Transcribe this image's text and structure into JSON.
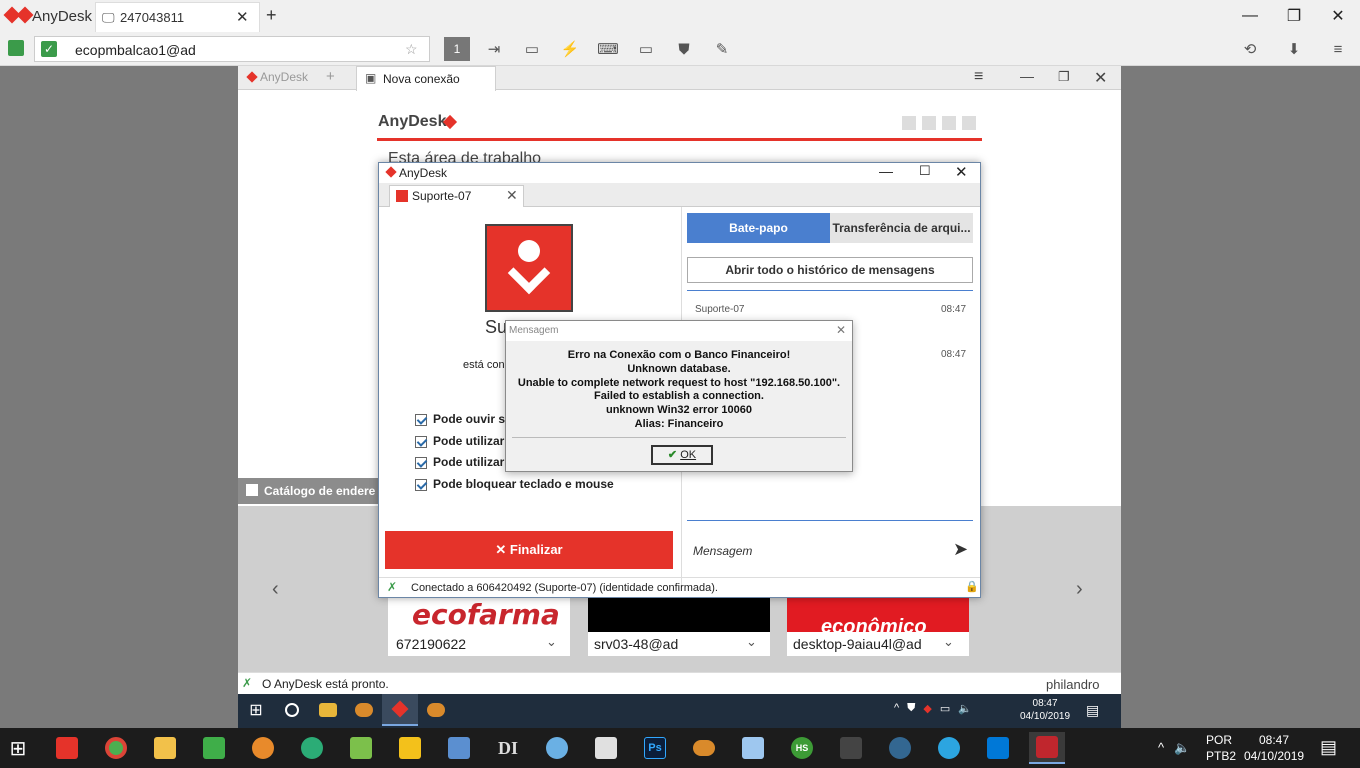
{
  "outer": {
    "app_name": "AnyDesk",
    "tab_label": "247043811",
    "address": "ecopmbalcao1@ad",
    "monitor_number": "1"
  },
  "inner": {
    "tab_anydesk": "AnyDesk",
    "tab_new": "Nova conexão",
    "logo_text": "AnyDesk",
    "desktop_heading": "Esta área de trabalho",
    "catalog_label": "Catálogo de endere",
    "status_ready": "O AnyDesk está pronto.",
    "brand": "philandro",
    "cards": [
      {
        "id": "672190622",
        "logo": "ecofarma"
      },
      {
        "id": "srv03-48@ad",
        "logo": ""
      },
      {
        "id": "desktop-9aiau4l@ad",
        "logo": "econômico"
      }
    ]
  },
  "dialog": {
    "title": "AnyDesk",
    "tab": "Suporte-07",
    "user_name": "Suporte-07",
    "connected_text": "está con",
    "permissions": [
      "Pode ouvir s",
      "Pode utilizar",
      "Pode utilizar",
      "Pode bloquear teclado e mouse"
    ],
    "finish_label": "Finalizar",
    "chat_tab": "Bate-papo",
    "transfer_tab": "Transferência de arqui...",
    "history_button": "Abrir todo o histórico de mensagens",
    "chat_entries": [
      {
        "sender": "Suporte-07",
        "time": "08:47"
      },
      {
        "sender": "",
        "time": "08:47"
      }
    ],
    "message_placeholder": "Mensagem",
    "status": "Conectado a 606420492 (Suporte-07) (identidade confirmada)."
  },
  "msgbox": {
    "title": "Mensagem",
    "lines": [
      "Erro na Conexão com o Banco Financeiro!",
      "Unknown database.",
      "Unable to complete network request to host \"192.168.50.100\".",
      "Failed to establish a connection.",
      "unknown Win32 error 10060",
      "Alias: Financeiro"
    ],
    "ok": "OK"
  },
  "inner_tray": {
    "time": "08:47",
    "date": "04/10/2019"
  },
  "outer_tray": {
    "lang": "POR",
    "layout": "PTB2",
    "time": "08:47",
    "date": "04/10/2019"
  },
  "colors": {
    "accent": "#e5332a",
    "chat_tab": "#4a7fcf",
    "taskbar": "#1c1c1c"
  }
}
